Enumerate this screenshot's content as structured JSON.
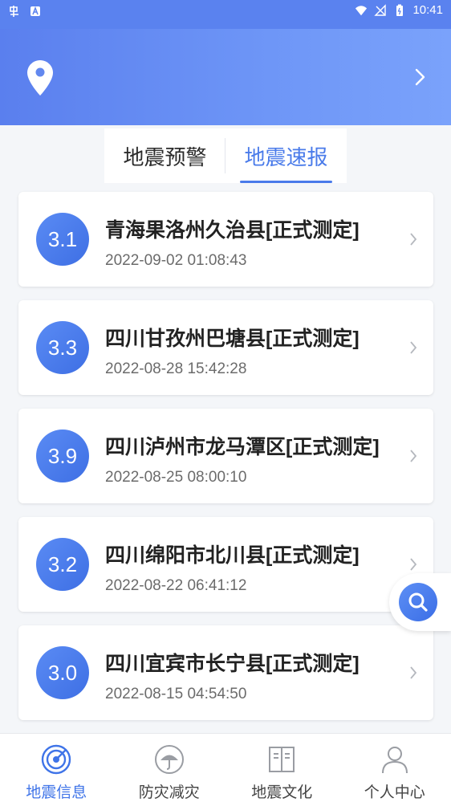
{
  "status_bar": {
    "time": "10:41"
  },
  "tabs": [
    {
      "label": "地震预警",
      "active": false
    },
    {
      "label": "地震速报",
      "active": true
    }
  ],
  "earthquakes": [
    {
      "magnitude": "3.1",
      "location": "青海果洛州久治县[正式测定]",
      "time": "2022-09-02 01:08:43"
    },
    {
      "magnitude": "3.3",
      "location": "四川甘孜州巴塘县[正式测定]",
      "time": "2022-08-28 15:42:28"
    },
    {
      "magnitude": "3.9",
      "location": "四川泸州市龙马潭区[正式测定]",
      "time": "2022-08-25 08:00:10"
    },
    {
      "magnitude": "3.2",
      "location": "四川绵阳市北川县[正式测定]",
      "time": "2022-08-22 06:41:12"
    },
    {
      "magnitude": "3.0",
      "location": "四川宜宾市长宁县[正式测定]",
      "time": "2022-08-15 04:54:50"
    }
  ],
  "bottom_nav": [
    {
      "label": "地震信息",
      "icon": "radar-icon",
      "active": true
    },
    {
      "label": "防灾减灾",
      "icon": "umbrella-icon",
      "active": false
    },
    {
      "label": "地震文化",
      "icon": "book-icon",
      "active": false
    },
    {
      "label": "个人中心",
      "icon": "person-icon",
      "active": false
    }
  ],
  "colors": {
    "accent": "#4a7bea",
    "header_start": "#5a7fee",
    "header_end": "#7aa2fb"
  }
}
